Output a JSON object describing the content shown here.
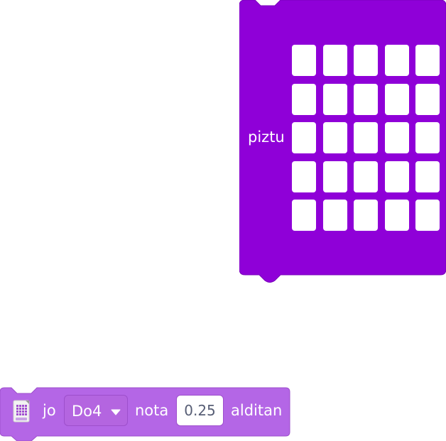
{
  "colors": {
    "matrix_block_fill": "#8f00d8",
    "matrix_block_stroke": "#7a00bb",
    "music_block_fill": "#b466e6",
    "music_block_stroke": "#9d4fcc",
    "led_off": "#ffffff",
    "input_text": "#575e75"
  },
  "matrix_block": {
    "label": "piztu",
    "leds": [
      [
        false,
        false,
        false,
        false,
        false
      ],
      [
        false,
        false,
        false,
        false,
        false
      ],
      [
        false,
        false,
        false,
        false,
        false
      ],
      [
        false,
        false,
        false,
        false,
        false
      ],
      [
        false,
        false,
        false,
        false,
        false
      ]
    ]
  },
  "music_block": {
    "icon": "microbit-extension-icon",
    "verb": "jo",
    "note": {
      "value": "Do4",
      "icon": "caret-down-icon"
    },
    "note_word": "nota",
    "duration": "0.25",
    "suffix": "alditan"
  }
}
